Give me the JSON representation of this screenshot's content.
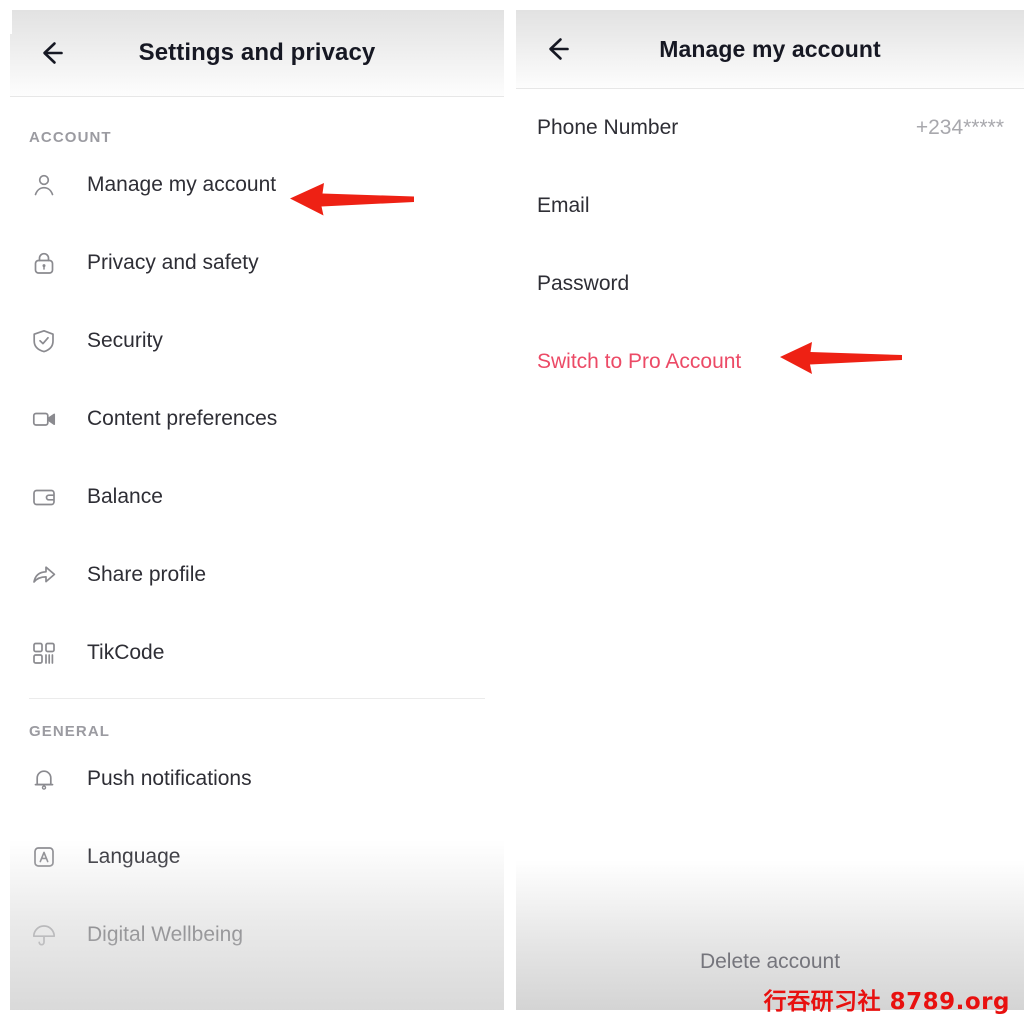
{
  "left_panel": {
    "header": {
      "back_icon": "back-arrow-icon",
      "title": "Settings and privacy"
    },
    "sections": [
      {
        "label": "ACCOUNT",
        "items": [
          {
            "label": "Manage my account",
            "icon": "person-icon"
          },
          {
            "label": "Privacy and safety",
            "icon": "lock-icon"
          },
          {
            "label": "Security",
            "icon": "shield-check-icon"
          },
          {
            "label": "Content preferences",
            "icon": "video-camera-icon"
          },
          {
            "label": "Balance",
            "icon": "wallet-icon"
          },
          {
            "label": "Share profile",
            "icon": "share-arrow-icon"
          },
          {
            "label": "TikCode",
            "icon": "qr-code-icon"
          }
        ]
      },
      {
        "label": "GENERAL",
        "items": [
          {
            "label": "Push notifications",
            "icon": "bell-icon"
          },
          {
            "label": "Language",
            "icon": "letter-a-box-icon"
          },
          {
            "label": "Digital Wellbeing",
            "icon": "umbrella-icon"
          }
        ]
      }
    ]
  },
  "right_panel": {
    "header": {
      "back_icon": "back-arrow-icon",
      "title": "Manage my account"
    },
    "rows": [
      {
        "label": "Phone Number",
        "value": "+234*****"
      },
      {
        "label": "Email",
        "value": ""
      },
      {
        "label": "Password",
        "value": ""
      },
      {
        "label": "Switch to Pro Account",
        "value": ""
      }
    ],
    "delete_account_label": "Delete account"
  },
  "annotations": {
    "arrow_color": "#ee2114",
    "arrow_left_target": "Manage my account",
    "arrow_right_target": "Switch to Pro Account"
  },
  "watermark": {
    "text": "行吞研习社 8789.org",
    "color": "#e8100f"
  },
  "colors": {
    "pro_account_accent": "#ec4a66",
    "primary_text": "#2e2e35",
    "muted_text": "#9b9ba1",
    "header_title": "#161823"
  }
}
